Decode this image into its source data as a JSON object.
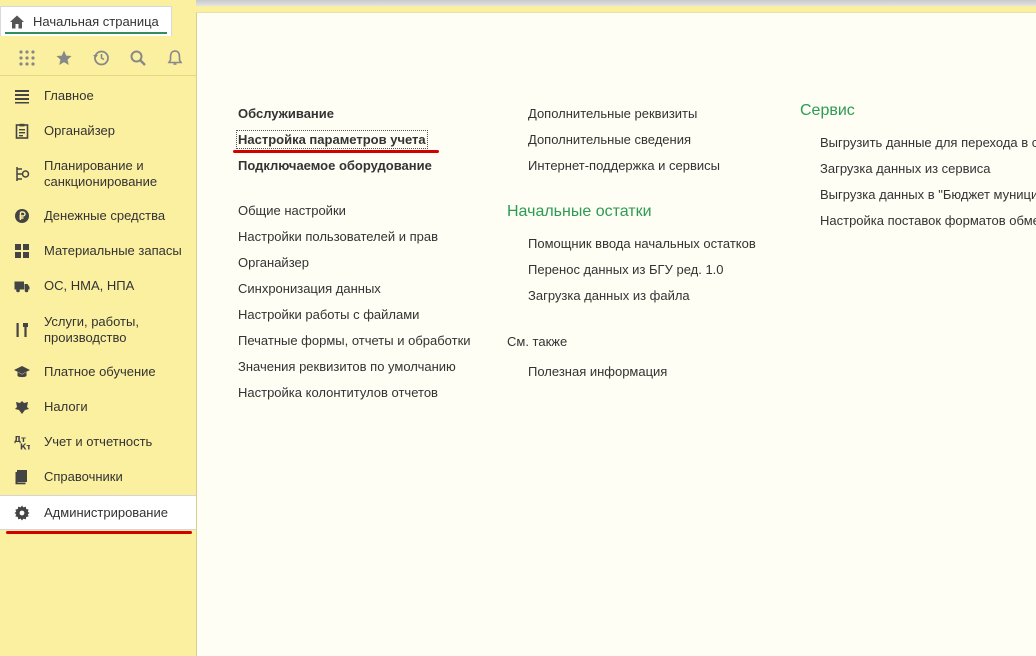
{
  "top": {
    "home_tab_label": "Начальная страница"
  },
  "quickbar": {
    "icons": [
      "apps-grid-icon",
      "favorites-star-icon",
      "history-icon",
      "search-icon",
      "notifications-bell-icon"
    ]
  },
  "sidebar": {
    "items": [
      {
        "label": "Главное",
        "icon": "menu-lines-icon"
      },
      {
        "label": "Органайзер",
        "icon": "clipboard-icon"
      },
      {
        "label": "Планирование и санкционирование",
        "icon": "planning-icon"
      },
      {
        "label": "Денежные средства",
        "icon": "ruble-coin-icon"
      },
      {
        "label": "Материальные запасы",
        "icon": "inventory-grid-icon"
      },
      {
        "label": "ОС, НМА, НПА",
        "icon": "truck-icon"
      },
      {
        "label": "Услуги, работы, производство",
        "icon": "tools-icon"
      },
      {
        "label": "Платное обучение",
        "icon": "graduation-cap-icon"
      },
      {
        "label": "Налоги",
        "icon": "coat-of-arms-icon"
      },
      {
        "label": "Учет и отчетность",
        "icon": "debit-credit-icon"
      },
      {
        "label": "Справочники",
        "icon": "books-icon"
      },
      {
        "label": "Администрирование",
        "icon": "gear-icon",
        "active": true
      }
    ]
  },
  "content": {
    "col1": {
      "bold_links": [
        "Обслуживание",
        "Настройка параметров учета",
        "Подключаемое оборудование"
      ],
      "links": [
        "Общие настройки",
        "Настройки пользователей и прав",
        "Органайзер",
        "Синхронизация данных",
        "Настройки работы с файлами",
        "Печатные формы, отчеты и обработки",
        "Значения реквизитов по умолчанию",
        "Настройка колонтитулов отчетов"
      ]
    },
    "col2": {
      "links_top": [
        "Дополнительные реквизиты",
        "Дополнительные сведения",
        "Интернет-поддержка и сервисы"
      ],
      "initial_heading": "Начальные остатки",
      "initial_links": [
        "Помощник ввода начальных остатков",
        "Перенос данных из БГУ ред. 1.0",
        "Загрузка данных из файла"
      ],
      "see_also_label": "См. также",
      "see_also_links": [
        "Полезная информация"
      ]
    },
    "col3": {
      "heading": "Сервис",
      "links": [
        "Выгрузить данные для перехода в с",
        "Загрузка данных из сервиса",
        "Выгрузка данных в \"Бюджет муници",
        "Настройка поставок форматов обме"
      ]
    },
    "colors": {
      "heading_green": "#2c9b53",
      "sidebar_yellow": "#fbf0a0",
      "annotation_red": "#d40000"
    }
  }
}
